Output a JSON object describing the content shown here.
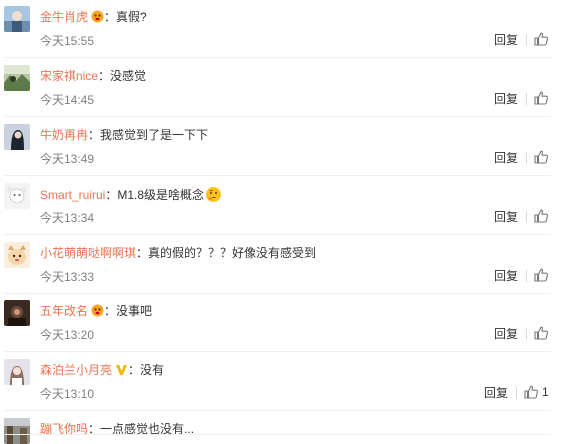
{
  "comments": [
    {
      "username": "金牛肖虎",
      "badge": "orange-emoji-badge",
      "separator": "：",
      "text": "真假?",
      "time": "今天15:55",
      "reply_label": "回复",
      "like_count": "",
      "avatar": "photo-avatar-blue"
    },
    {
      "username": "宋家祺nice",
      "badge": "",
      "separator": "：",
      "text": "没感觉",
      "time": "今天14:45",
      "reply_label": "回复",
      "like_count": "",
      "avatar": "photo-avatar-green"
    },
    {
      "username": "牛奶再冉",
      "badge": "",
      "separator": "：",
      "text": "我感觉到了是一下下",
      "time": "今天13:49",
      "reply_label": "回复",
      "like_count": "",
      "avatar": "photo-avatar-dark"
    },
    {
      "username": "Smart_ruirui",
      "badge": "",
      "separator": "：",
      "text": "M1.8级是啥概念",
      "emoji": "thinking-emoji",
      "time": "今天13:34",
      "reply_label": "回复",
      "like_count": "",
      "avatar": "photo-avatar-white"
    },
    {
      "username": "小花萌萌哒啊啊琪",
      "badge": "",
      "separator": "：",
      "text": "真的假的？？？好像没有感受到",
      "time": "今天13:33",
      "reply_label": "回复",
      "like_count": "",
      "avatar": "cartoon-avatar"
    },
    {
      "username": "五年改名",
      "badge": "orange-emoji-badge",
      "separator": "：",
      "text": "没事吧",
      "time": "今天13:20",
      "reply_label": "回复",
      "like_count": "",
      "avatar": "photo-avatar-brown"
    },
    {
      "username": "森泊兰小月亮",
      "badge": "v-badge-yellow",
      "separator": "：",
      "text": "没有",
      "time": "今天13:10",
      "reply_label": "回复",
      "like_count": "1",
      "avatar": "photo-avatar-light"
    },
    {
      "username": "蹦飞你吗",
      "badge": "",
      "separator": "：",
      "text": "一点感觉也没有...",
      "time": "",
      "reply_label": "",
      "like_count": "",
      "avatar": "photo-avatar-street"
    }
  ],
  "colors": {
    "username": "#eb7350",
    "text": "#333333",
    "time": "#808080",
    "divider": "#efefef"
  },
  "icons": {
    "like": "thumbs-up-icon"
  }
}
